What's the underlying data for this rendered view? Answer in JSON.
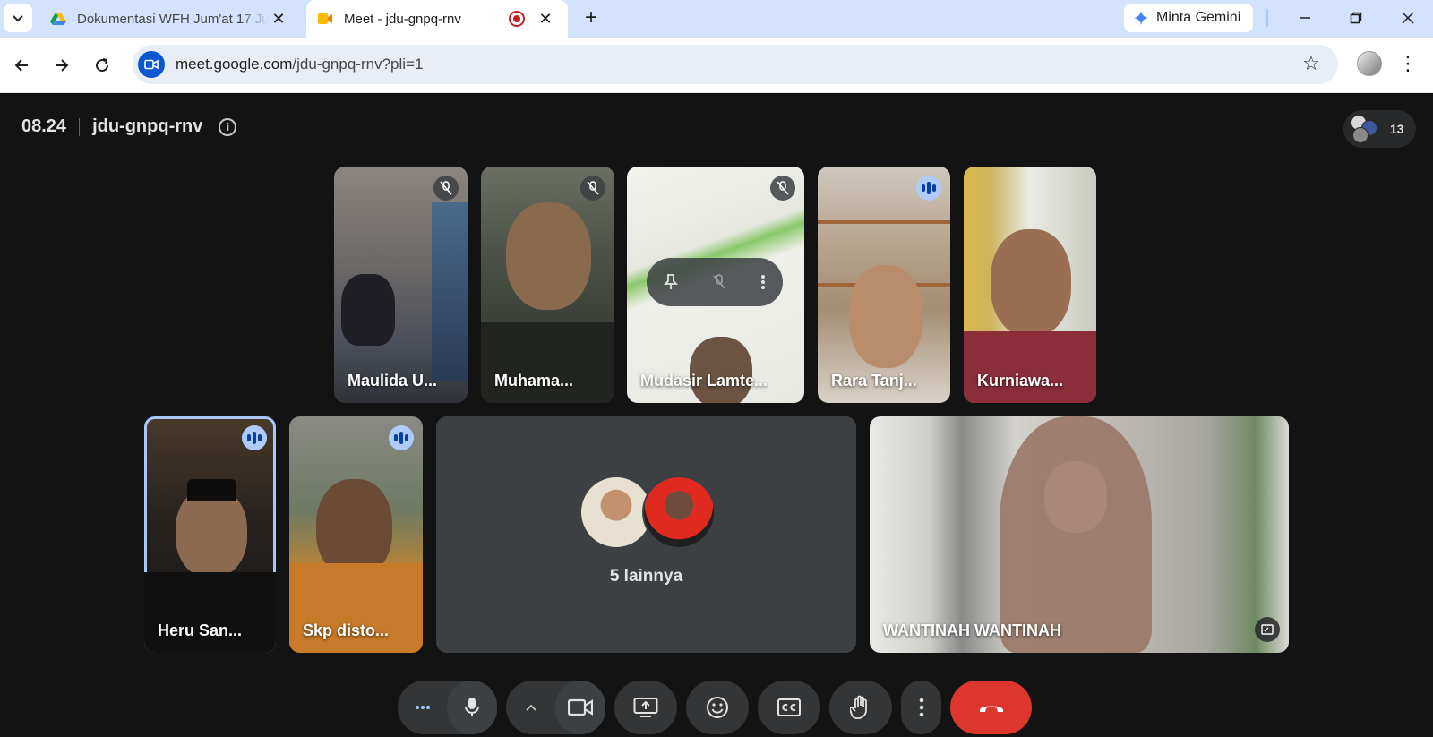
{
  "browser": {
    "tabs": [
      {
        "title": "Dokumentasi WFH Jum'at 17 Ju"
      },
      {
        "title": "Meet - jdu-gnpq-rnv"
      }
    ],
    "gemini_label": "Minta Gemini",
    "url_host": "meet.google.com",
    "url_path": "/jdu-gnpq-rnv?pli=1"
  },
  "meet": {
    "time": "08.24",
    "code": "jdu-gnpq-rnv",
    "participant_count": "13",
    "top_row": [
      {
        "name": "Maulida U...",
        "state": "muted"
      },
      {
        "name": "Muhama...",
        "state": "muted"
      },
      {
        "name": "Mudasir Lamte...",
        "state": "muted"
      },
      {
        "name": "Rara Tanj...",
        "state": "talking"
      },
      {
        "name": "Kurniawa...",
        "state": "none"
      }
    ],
    "bottom_row": [
      {
        "name": "Heru San...",
        "state": "talking"
      },
      {
        "name": "Skp disto...",
        "state": "talking"
      }
    ],
    "others_label": "5 lainnya",
    "featured_name": "WANTINAH WANTINAH"
  },
  "colors": {
    "background": "#131314",
    "tile": "#3c4043",
    "end_call": "#dc362e",
    "talk_badge": "#aecbfa"
  }
}
